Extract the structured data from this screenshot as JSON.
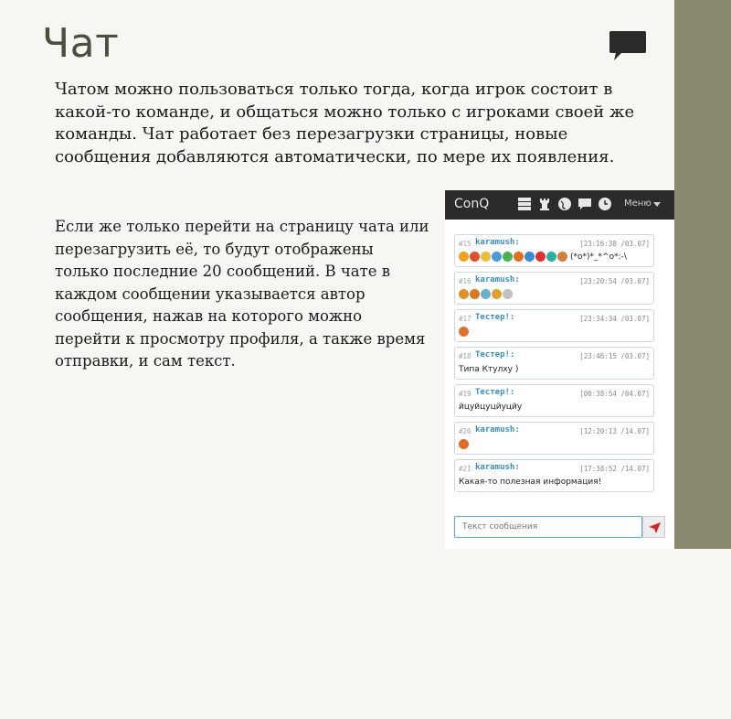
{
  "slide": {
    "title": "Чат",
    "intro": "Чатом можно пользоваться только тогда, когда игрок состоит в какой-то команде, и общаться можно только с игроками своей же команды. Чат работает без перезагрузки страницы, новые сообщения добавляются автоматически, по мере их появления.",
    "details": "Если же только перейти на страницу чата или перезагрузить её, то будут отображены только последние 20 сообщений. В чате в каждом сообщении указывается автор сообщения, нажав на которого можно перейти к просмотру профиля, а также время отправки, и сам текст."
  },
  "app": {
    "brand": "ConQ",
    "menu_label": "Меню",
    "header_icons": [
      "server-icon",
      "chess-rook-icon",
      "globe-icon",
      "chat-icon",
      "clock-icon"
    ]
  },
  "messages": [
    {
      "num": "#15",
      "author": "karamush:",
      "time": "[23:16:38 /03.07]",
      "text": "(*o*)*_*^o*:-\\",
      "emoji_colors": [
        "#f0a020",
        "#e05030",
        "#e7c040",
        "#4a9ad8",
        "#4ab050",
        "#e07020",
        "#3a8ad0",
        "#e03030",
        "#2ab0a0",
        "#d08040"
      ]
    },
    {
      "num": "#16",
      "author": "karamush:",
      "time": "[23:20:54 /03.07]",
      "text": "",
      "emoji_colors": [
        "#e0902a",
        "#d87a20",
        "#6ab0d0",
        "#e0a030",
        "#c0c0c0"
      ]
    },
    {
      "num": "#17",
      "author": "Тестер!:",
      "time": "[23:34:34 /03.07]",
      "text": "",
      "emoji_colors": [
        "#e07030"
      ]
    },
    {
      "num": "#18",
      "author": "Тестер!:",
      "time": "[23:46:15 /03.07]",
      "text": "Типа Ктулху )",
      "emoji_colors": []
    },
    {
      "num": "#19",
      "author": "Тестер!:",
      "time": "[00:38:54 /04.07]",
      "text": "йцуйцуцйуцйу",
      "emoji_colors": []
    },
    {
      "num": "#20",
      "author": "karamush:",
      "time": "[12:20:13 /14.07]",
      "text": "",
      "emoji_colors": [
        "#e06a20"
      ]
    },
    {
      "num": "#21",
      "author": "karamush:",
      "time": "[17:38:52 /14.07]",
      "text": "Какая-то полезная информация!",
      "emoji_colors": []
    }
  ],
  "input": {
    "placeholder": "Текст сообщения"
  },
  "colors": {
    "accent": "#3a8dc0",
    "send": "#e02020",
    "side_stripe": "#8a8a6e"
  }
}
